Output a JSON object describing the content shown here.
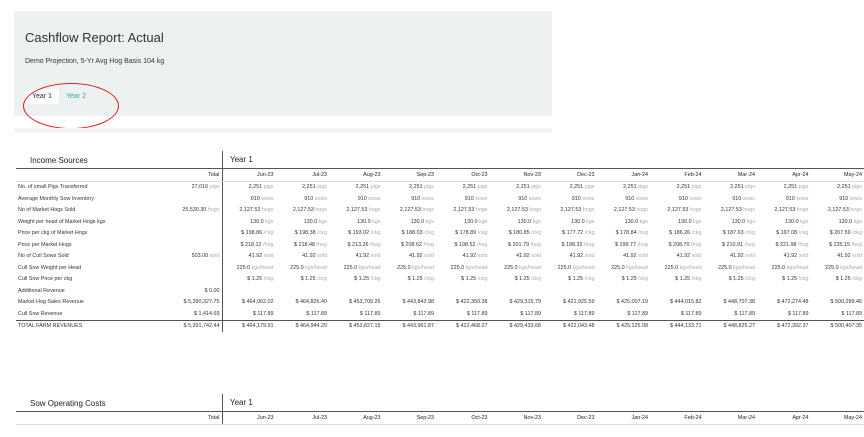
{
  "header": {
    "title": "Cashflow Report: Actual",
    "subtitle": "Demo Projection, 5-Yr Avg Hog Basis 104 kg",
    "tabs": [
      {
        "label": "Year 1",
        "active": true
      },
      {
        "label": "Year 2",
        "active": false
      }
    ]
  },
  "months": [
    "Jun-23",
    "Jul-23",
    "Aug-23",
    "Sep-23",
    "Oct-23",
    "Nov-23",
    "Dec-23",
    "Jan-24",
    "Feb-24",
    "Mar-24",
    "Apr-24",
    "May-24"
  ],
  "income": {
    "title": "Income Sources",
    "year": "Year 1",
    "total_header": "Total",
    "rows": [
      {
        "label": "No. of small Pigs Transferred",
        "total": "27,016",
        "total_unit": "pigs",
        "cells": [
          "2,251",
          "2,251",
          "2,251",
          "2,251",
          "2,251",
          "2,251",
          "2,251",
          "2,251",
          "2,251",
          "2,251",
          "2,251",
          "2,251"
        ],
        "prefix": "",
        "unit": "pigs"
      },
      {
        "label": "Average Monthly Sow Inventory",
        "total": "",
        "total_unit": "",
        "cells": [
          "910",
          "910",
          "910",
          "910",
          "910",
          "910",
          "910",
          "910",
          "910",
          "910",
          "910",
          "910"
        ],
        "prefix": "",
        "unit": "sows"
      },
      {
        "label": "No of Market Hogs Sold",
        "total": "25,530.30",
        "total_unit": "hogs",
        "cells": [
          "2,127.53",
          "2,127.53",
          "2,127.53",
          "2,127.53",
          "2,127.53",
          "2,127.53",
          "2,127.53",
          "2,127.53",
          "2,127.53",
          "2,127.53",
          "2,127.53",
          "2,127.53"
        ],
        "prefix": "",
        "unit": "hogs"
      },
      {
        "label": "Weight per head of Market Hogs kgs",
        "total": "",
        "total_unit": "",
        "cells": [
          "130.0",
          "130.0",
          "130.0",
          "130.0",
          "130.0",
          "130.0",
          "130.0",
          "130.0",
          "130.0",
          "130.0",
          "130.0",
          "130.0"
        ],
        "prefix": "",
        "unit": "kgs"
      },
      {
        "label": "Price per ckg of Market Hogs",
        "total": "",
        "total_unit": "",
        "cells": [
          "198.86",
          "198.38",
          "193.02",
          "188.03",
          "178.89",
          "180.85",
          "177.72",
          "178.84",
          "186.26",
          "187.63",
          "197.08",
          "207.59"
        ],
        "prefix": "$ ",
        "unit": "/ckg"
      },
      {
        "label": "Price per Market Hogs",
        "total": "",
        "total_unit": "",
        "cells": [
          "218.12",
          "218.48",
          "213.26",
          "208.62",
          "198.52",
          "201.79",
          "198.32",
          "199.77",
          "208.70",
          "210.91",
          "221.98",
          "235.15"
        ],
        "prefix": "$ ",
        "unit": "/hog"
      },
      {
        "label": "No of Cull Sows Sold",
        "total": "503.00",
        "total_unit": "sold",
        "cells": [
          "41.92",
          "41.92",
          "41.92",
          "41.92",
          "41.92",
          "41.92",
          "41.92",
          "41.92",
          "41.92",
          "41.92",
          "41.92",
          "41.92"
        ],
        "prefix": "",
        "unit": "sold"
      },
      {
        "label": "Cull Sow Weight per Head",
        "total": "",
        "total_unit": "",
        "cells": [
          "225.0",
          "225.0",
          "225.0",
          "225.0",
          "225.0",
          "225.0",
          "225.0",
          "225.0",
          "225.0",
          "225.0",
          "225.0",
          "225.0"
        ],
        "prefix": "",
        "unit": "kgs/head"
      },
      {
        "label": "Cull Sow Price per ckg",
        "total": "",
        "total_unit": "",
        "cells": [
          "1.25",
          "1.25",
          "1.25",
          "1.25",
          "1.25",
          "1.25",
          "1.25",
          "1.25",
          "1.25",
          "1.25",
          "1.25",
          "1.25"
        ],
        "prefix": "$ ",
        "unit": "/ckg"
      },
      {
        "label": "Additional Revenue",
        "total": "$ 0.00",
        "total_unit": "",
        "cells": [
          "",
          "",
          "",
          "",
          "",
          "",
          "",
          "",
          "",
          "",
          "",
          ""
        ],
        "prefix": "",
        "unit": ""
      },
      {
        "label": "Market Hog Sales Revenue",
        "total": "$ 5,390,327.75",
        "total_unit": "",
        "cells": [
          "$ 464,062.02",
          "$ 464,826.40",
          "$ 453,709.26",
          "$ 443,843.98",
          "$ 422,350.38",
          "$ 429,315.79",
          "$ 421,925.59",
          "$ 425,007.19",
          "$ 444,015.82",
          "$ 448,707.38",
          "$ 472,274.48",
          "$ 500,289.46"
        ],
        "prefix": "",
        "unit": ""
      },
      {
        "label": "Cull Sow Revenue",
        "total": "$ 1,414.69",
        "total_unit": "",
        "cells": [
          "$ 117.89",
          "$ 117.89",
          "$ 117.89",
          "$ 117.89",
          "$ 117.89",
          "$ 117.89",
          "$ 117.89",
          "$ 117.89",
          "$ 117.89",
          "$ 117.89",
          "$ 117.89",
          "$ 117.89"
        ],
        "prefix": "",
        "unit": ""
      }
    ],
    "total_row": {
      "label": "TOTAL FARM REVENUES",
      "total": "$ 5,391,742.44",
      "cells": [
        "$ 464,179.91",
        "$ 464,944.29",
        "$ 453,827.15",
        "$ 443,961.87",
        "$ 422,468.27",
        "$ 429,433.68",
        "$ 422,043.48",
        "$ 425,125.08",
        "$ 444,133.71",
        "$ 448,825.27",
        "$ 472,392.37",
        "$ 500,407.35"
      ]
    }
  },
  "sow_costs": {
    "title": "Sow Operating Costs",
    "year": "Year 1",
    "total_header": "Total"
  }
}
